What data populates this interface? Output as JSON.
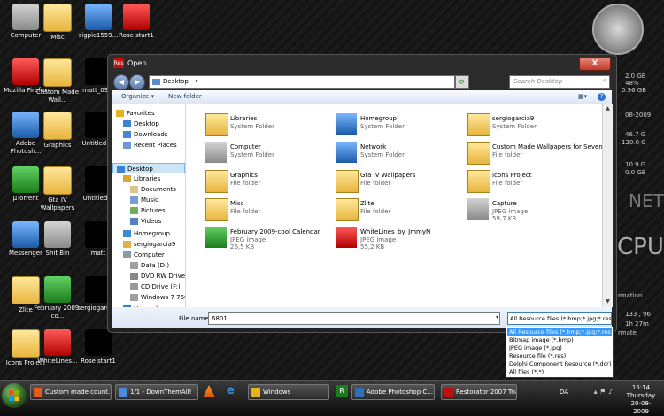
{
  "desktop_icons": [
    {
      "label": "Computer",
      "style": "gray"
    },
    {
      "label": "Misc",
      "style": "folder"
    },
    {
      "label": "sigpic1559...",
      "style": "blue"
    },
    {
      "label": "Rose start1",
      "style": "redbox"
    },
    {
      "label": "Mozilla Firefox",
      "style": "redbox"
    },
    {
      "label": "Custom Made Wall...",
      "style": "folder"
    },
    {
      "label": "matt_09...",
      "style": "black"
    },
    {
      "label": "Adobe Photosh...",
      "style": "blue"
    },
    {
      "label": "Graphics",
      "style": "folder"
    },
    {
      "label": "Untitled-...",
      "style": "black"
    },
    {
      "label": "µTorrent",
      "style": "green"
    },
    {
      "label": "Gta IV Wallpapers",
      "style": "folder"
    },
    {
      "label": "Untitled-1",
      "style": "black"
    },
    {
      "label": "Messenger",
      "style": "blue"
    },
    {
      "label": "Shit Bin",
      "style": "gray"
    },
    {
      "label": "matt",
      "style": "black"
    },
    {
      "label": "Zlite",
      "style": "folder"
    },
    {
      "label": "February 2009-co...",
      "style": "green"
    },
    {
      "label": "sergiogarcia9",
      "style": "black"
    },
    {
      "label": "Icons Project",
      "style": "folder"
    },
    {
      "label": "WhiteLines...",
      "style": "redbox"
    },
    {
      "label": "Rose start1",
      "style": "black"
    }
  ],
  "gadgets": {
    "mem1": "2.0 GB",
    "pct": "48%",
    "mem2": "0.96 GB",
    "temp1": "46.7 G",
    "temp2": "120.0 G",
    "disk1": "10.9 G",
    "disk2": "0.0 GB",
    "net": "NET",
    "cpu": "CPU",
    "date_gadget": "08-2009",
    "rmation": "rmation",
    "nums": "133 , 96",
    "time_left": "1h 27m",
    "rmate": "rmate"
  },
  "dialog": {
    "title": "Open",
    "close_label": "X",
    "address": "Desktop",
    "search_placeholder": "Search Desktop",
    "toolbar": {
      "organize": "Organize",
      "new_folder": "New folder"
    },
    "nav": [
      {
        "label": "Favorites",
        "icon": "star-icon",
        "color": "#e8b21f",
        "indent": 0
      },
      {
        "label": "Desktop",
        "icon": "desktop-icon",
        "color": "#3f7fd4",
        "indent": 1
      },
      {
        "label": "Downloads",
        "icon": "downloads-icon",
        "color": "#4a84d6",
        "indent": 1
      },
      {
        "label": "Recent Places",
        "icon": "recent-places-icon",
        "color": "#6a9ad8",
        "indent": 1
      },
      {
        "label": "Desktop",
        "icon": "desktop-icon",
        "color": "#3f7fd4",
        "indent": 0,
        "selected": true
      },
      {
        "label": "Libraries",
        "icon": "libraries-icon",
        "color": "#d9a52c",
        "indent": 1
      },
      {
        "label": "Documents",
        "icon": "documents-icon",
        "color": "#d9c68a",
        "indent": 2
      },
      {
        "label": "Music",
        "icon": "music-icon",
        "color": "#7a9ed1",
        "indent": 2
      },
      {
        "label": "Pictures",
        "icon": "pictures-icon",
        "color": "#6fae5a",
        "indent": 2
      },
      {
        "label": "Videos",
        "icon": "videos-icon",
        "color": "#5a7fbf",
        "indent": 2
      },
      {
        "label": "Homegroup",
        "icon": "homegroup-icon",
        "color": "#3b8bd4",
        "indent": 1
      },
      {
        "label": "sergiogarcia9",
        "icon": "user-icon",
        "color": "#e2b34a",
        "indent": 1
      },
      {
        "label": "Computer",
        "icon": "computer-icon",
        "color": "#8c9aae",
        "indent": 1
      },
      {
        "label": "Data (D:)",
        "icon": "drive-icon",
        "color": "#a0a0a0",
        "indent": 2
      },
      {
        "label": "DVD RW Drive (",
        "icon": "dvd-icon",
        "color": "#888",
        "indent": 2
      },
      {
        "label": "CD Drive (F:)",
        "icon": "cd-icon",
        "color": "#999",
        "indent": 2
      },
      {
        "label": "Windows 7 760",
        "icon": "drive-icon",
        "color": "#a0a0a0",
        "indent": 2
      },
      {
        "label": "Network",
        "icon": "network-icon",
        "color": "#3b7bd0",
        "indent": 1
      }
    ],
    "files": [
      {
        "name": "Libraries",
        "type": "System Folder",
        "size": "",
        "icon": "libraries-icon",
        "style": "folder"
      },
      {
        "name": "Homegroup",
        "type": "System Folder",
        "size": "",
        "icon": "homegroup-icon",
        "style": "blue"
      },
      {
        "name": "sergiogarcia9",
        "type": "System Folder",
        "size": "",
        "icon": "user-folder-icon",
        "style": "folder"
      },
      {
        "name": "Computer",
        "type": "System Folder",
        "size": "",
        "icon": "computer-icon",
        "style": "gray"
      },
      {
        "name": "Network",
        "type": "System Folder",
        "size": "",
        "icon": "network-icon",
        "style": "blue"
      },
      {
        "name": "Custom Made Wallpapers for Sevenforums.com",
        "type": "File folder",
        "size": "",
        "icon": "folder-icon",
        "style": "folder"
      },
      {
        "name": "Graphics",
        "type": "File folder",
        "size": "",
        "icon": "folder-icon",
        "style": "folder"
      },
      {
        "name": "Gta IV Wallpapers",
        "type": "File folder",
        "size": "",
        "icon": "folder-icon",
        "style": "folder"
      },
      {
        "name": "Icons Project",
        "type": "File folder",
        "size": "",
        "icon": "folder-icon",
        "style": "folder"
      },
      {
        "name": "Misc",
        "type": "File folder",
        "size": "",
        "icon": "folder-icon",
        "style": "folder"
      },
      {
        "name": "Zlite",
        "type": "File folder",
        "size": "",
        "icon": "folder-icon",
        "style": "folder"
      },
      {
        "name": "Capture",
        "type": "JPEG image",
        "size": "59,7 KB",
        "icon": "image-icon",
        "style": "gray"
      },
      {
        "name": "February 2009-cool Calendar",
        "type": "JPEG image",
        "size": "26,5 KB",
        "icon": "image-icon",
        "style": "green"
      },
      {
        "name": "WhiteLines_by_JmmyN",
        "type": "JPEG image",
        "size": "55,2 KB",
        "icon": "image-icon",
        "style": "redbox"
      }
    ],
    "filename_label": "File name:",
    "filename_value": "6801",
    "filter_value": "All Resource files (*.bmp;*.jpg;*.res;*.dcr)",
    "filter_options": [
      "All Resource files (*.bmp;*.jpg;*.res;*.dcr)",
      "Bitmap image (*.bmp)",
      "JPEG image (*.jpg)",
      "Resource file (*.res)",
      "Delphi Component Resource (*.dcr)",
      "All files (*.*)"
    ]
  },
  "taskbar": {
    "items": [
      {
        "label": "Custom made count...",
        "color": "#e25a1c"
      },
      {
        "label": "1/1 - DownThemAll!",
        "color": "#4a8ad6"
      },
      {
        "label": "Windows",
        "color": "#e8b21f"
      },
      {
        "label": "Adobe Photoshop C...",
        "color": "#2d6fb8"
      },
      {
        "label": "Restorator 2007 Trial ...",
        "color": "#b11"
      }
    ],
    "lang": "DA",
    "time": "15:14",
    "day": "Thursday",
    "date": "20-08-2009"
  }
}
